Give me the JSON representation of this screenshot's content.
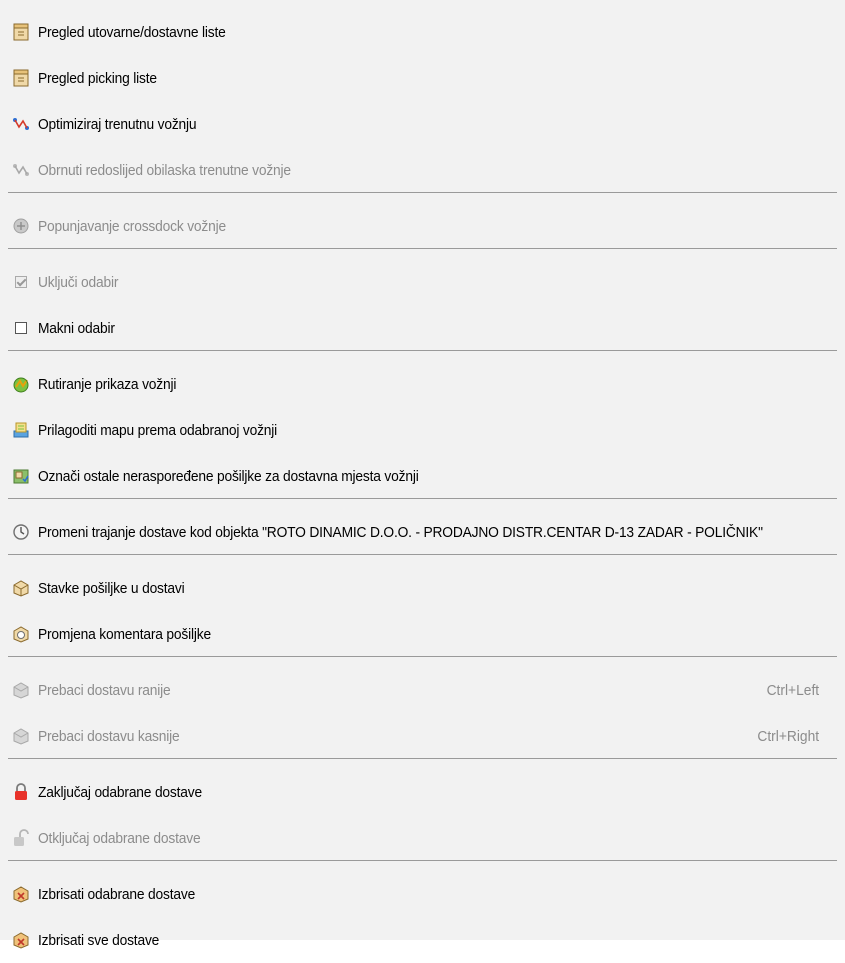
{
  "menu": {
    "items": [
      {
        "label": "Pregled utovarne/dostavne liste",
        "icon": "package-doc-icon",
        "disabled": false
      },
      {
        "label": "Pregled picking liste",
        "icon": "package-doc-icon",
        "disabled": false
      },
      {
        "label": "Optimiziraj trenutnu vožnju",
        "icon": "route-optimize-icon",
        "disabled": false
      },
      {
        "label": "Obrnuti redoslijed obilaska trenutne vožnje",
        "icon": "route-reverse-icon",
        "disabled": true
      },
      {
        "label": "Popunjavanje crossdock vožnje",
        "icon": "crossdock-icon",
        "disabled": true
      },
      {
        "label": "Uključi odabir",
        "icon": "checkbox-checked-icon",
        "disabled": true
      },
      {
        "label": "Makni odabir",
        "icon": "checkbox-empty-icon",
        "disabled": false
      },
      {
        "label": "Rutiranje prikaza vožnji",
        "icon": "routing-icon",
        "disabled": false
      },
      {
        "label": "Prilagoditi mapu prema odabranoj vožnji",
        "icon": "map-fit-icon",
        "disabled": false
      },
      {
        "label": "Označi ostale neraspoređene pošiljke za dostavna mjesta vožnji",
        "icon": "mark-shipments-icon",
        "disabled": false
      },
      {
        "label": "Promeni trajanje dostave kod objekta \"ROTO DINAMIC D.O.O. - PRODAJNO DISTR.CENTAR D-13 ZADAR - POLIČNIK\"",
        "icon": "clock-duration-icon",
        "disabled": false
      },
      {
        "label": "Stavke pošiljke u dostavi",
        "icon": "shipment-items-icon",
        "disabled": false
      },
      {
        "label": "Promjena komentara pošiljke",
        "icon": "shipment-comment-icon",
        "disabled": false
      },
      {
        "label": "Prebaci dostavu ranije",
        "icon": "move-earlier-icon",
        "disabled": true,
        "shortcut": "Ctrl+Left"
      },
      {
        "label": "Prebaci dostavu kasnije",
        "icon": "move-later-icon",
        "disabled": true,
        "shortcut": "Ctrl+Right"
      },
      {
        "label": "Zaključaj odabrane dostave",
        "icon": "lock-icon",
        "disabled": false
      },
      {
        "label": "Otključaj odabrane dostave",
        "icon": "unlock-icon",
        "disabled": true
      },
      {
        "label": "Izbrisati odabrane dostave",
        "icon": "delete-selected-icon",
        "disabled": false
      },
      {
        "label": "Izbrisati sve dostave",
        "icon": "delete-all-icon",
        "disabled": false
      }
    ]
  }
}
